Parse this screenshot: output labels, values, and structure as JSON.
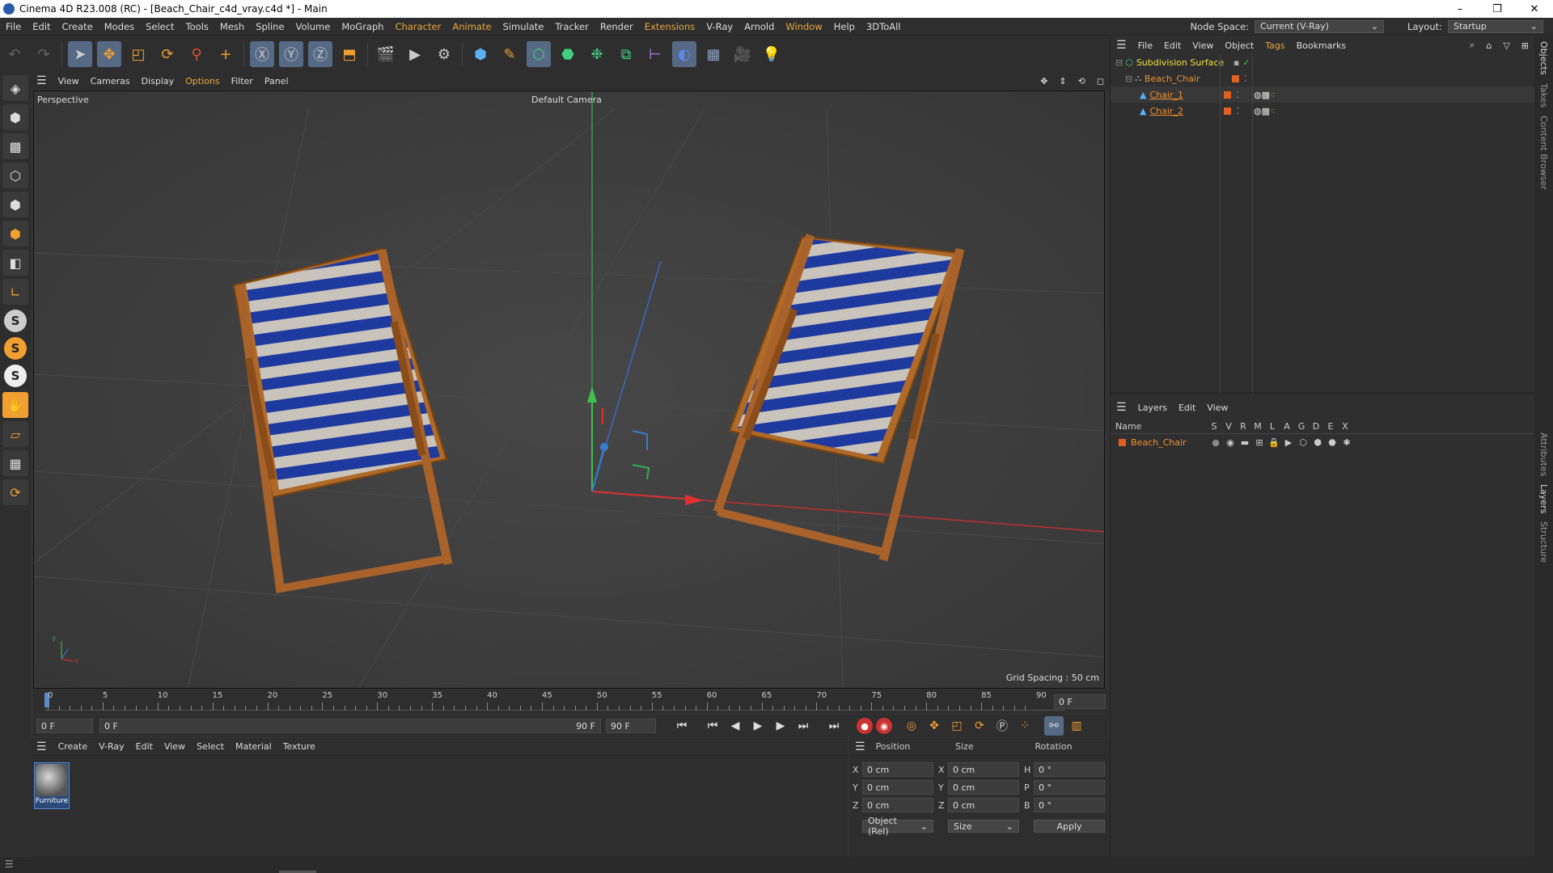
{
  "window": {
    "title": "Cinema 4D R23.008 (RC) - [Beach_Chair_c4d_vray.c4d *] - Main",
    "controls": [
      "–",
      "❐",
      "✕"
    ]
  },
  "menubar": {
    "items": [
      "File",
      "Edit",
      "Create",
      "Modes",
      "Select",
      "Tools",
      "Mesh",
      "Spline",
      "Volume",
      "MoGraph",
      "Character",
      "Animate",
      "Simulate",
      "Tracker",
      "Render",
      "Extensions",
      "V-Ray",
      "Arnold",
      "Window",
      "Help",
      "3DToAll"
    ],
    "node_space_label": "Node Space:",
    "node_space_value": "Current (V-Ray)",
    "layout_label": "Layout:",
    "layout_value": "Startup"
  },
  "viewport": {
    "menu": [
      "View",
      "Cameras",
      "Display",
      "Options",
      "Filter",
      "Panel"
    ],
    "name": "Perspective",
    "camera": "Default Camera",
    "grid_spacing": "Grid Spacing : 50 cm",
    "axis_y": "y",
    "axis_x": "x"
  },
  "timeline": {
    "ticks": [
      "0",
      "5",
      "10",
      "15",
      "20",
      "25",
      "30",
      "35",
      "40",
      "45",
      "50",
      "55",
      "60",
      "65",
      "70",
      "75",
      "80",
      "85",
      "90"
    ],
    "current_frame": "0 F"
  },
  "transport": {
    "start": "0 F",
    "range_start": "0 F",
    "range_end": "90 F",
    "end": "90 F"
  },
  "materials": {
    "menu": [
      "Create",
      "V-Ray",
      "Edit",
      "View",
      "Select",
      "Material",
      "Texture"
    ],
    "items": [
      {
        "name": "Furniture"
      }
    ]
  },
  "coords": {
    "headers": [
      "Position",
      "Size",
      "Rotation"
    ],
    "rows": [
      {
        "axis": "X",
        "pos": "0 cm",
        "size_axis": "X",
        "size": "0 cm",
        "rot_axis": "H",
        "rot": "0 °"
      },
      {
        "axis": "Y",
        "pos": "0 cm",
        "size_axis": "Y",
        "size": "0 cm",
        "rot_axis": "P",
        "rot": "0 °"
      },
      {
        "axis": "Z",
        "pos": "0 cm",
        "size_axis": "Z",
        "size": "0 cm",
        "rot_axis": "B",
        "rot": "0 °"
      }
    ],
    "mode": "Object (Rel)",
    "size_mode": "Size",
    "apply": "Apply"
  },
  "objects": {
    "menu": [
      "File",
      "Edit",
      "View",
      "Object",
      "Tags",
      "Bookmarks"
    ],
    "tree": [
      {
        "name": "Subdivision Surface",
        "level": 0,
        "color": "#f0e040"
      },
      {
        "name": "Beach_Chair",
        "level": 1,
        "color": "#f09030"
      },
      {
        "name": "Chair_1",
        "level": 2,
        "color": "#f09030"
      },
      {
        "name": "Chair_2",
        "level": 2,
        "color": "#f09030"
      }
    ]
  },
  "layers": {
    "menu": [
      "Layers",
      "Edit",
      "View"
    ],
    "columns": [
      "Name",
      "S",
      "V",
      "R",
      "M",
      "L",
      "A",
      "G",
      "D",
      "E",
      "X"
    ],
    "items": [
      {
        "name": "Beach_Chair"
      }
    ]
  },
  "side_tabs": [
    "Objects",
    "Takes",
    "Content Browser",
    "Attributes",
    "Layers",
    "Structure"
  ],
  "colors": {
    "accent": "#f09030",
    "stripe_blue": "#1f3a9e",
    "wood": "#b06a28"
  }
}
